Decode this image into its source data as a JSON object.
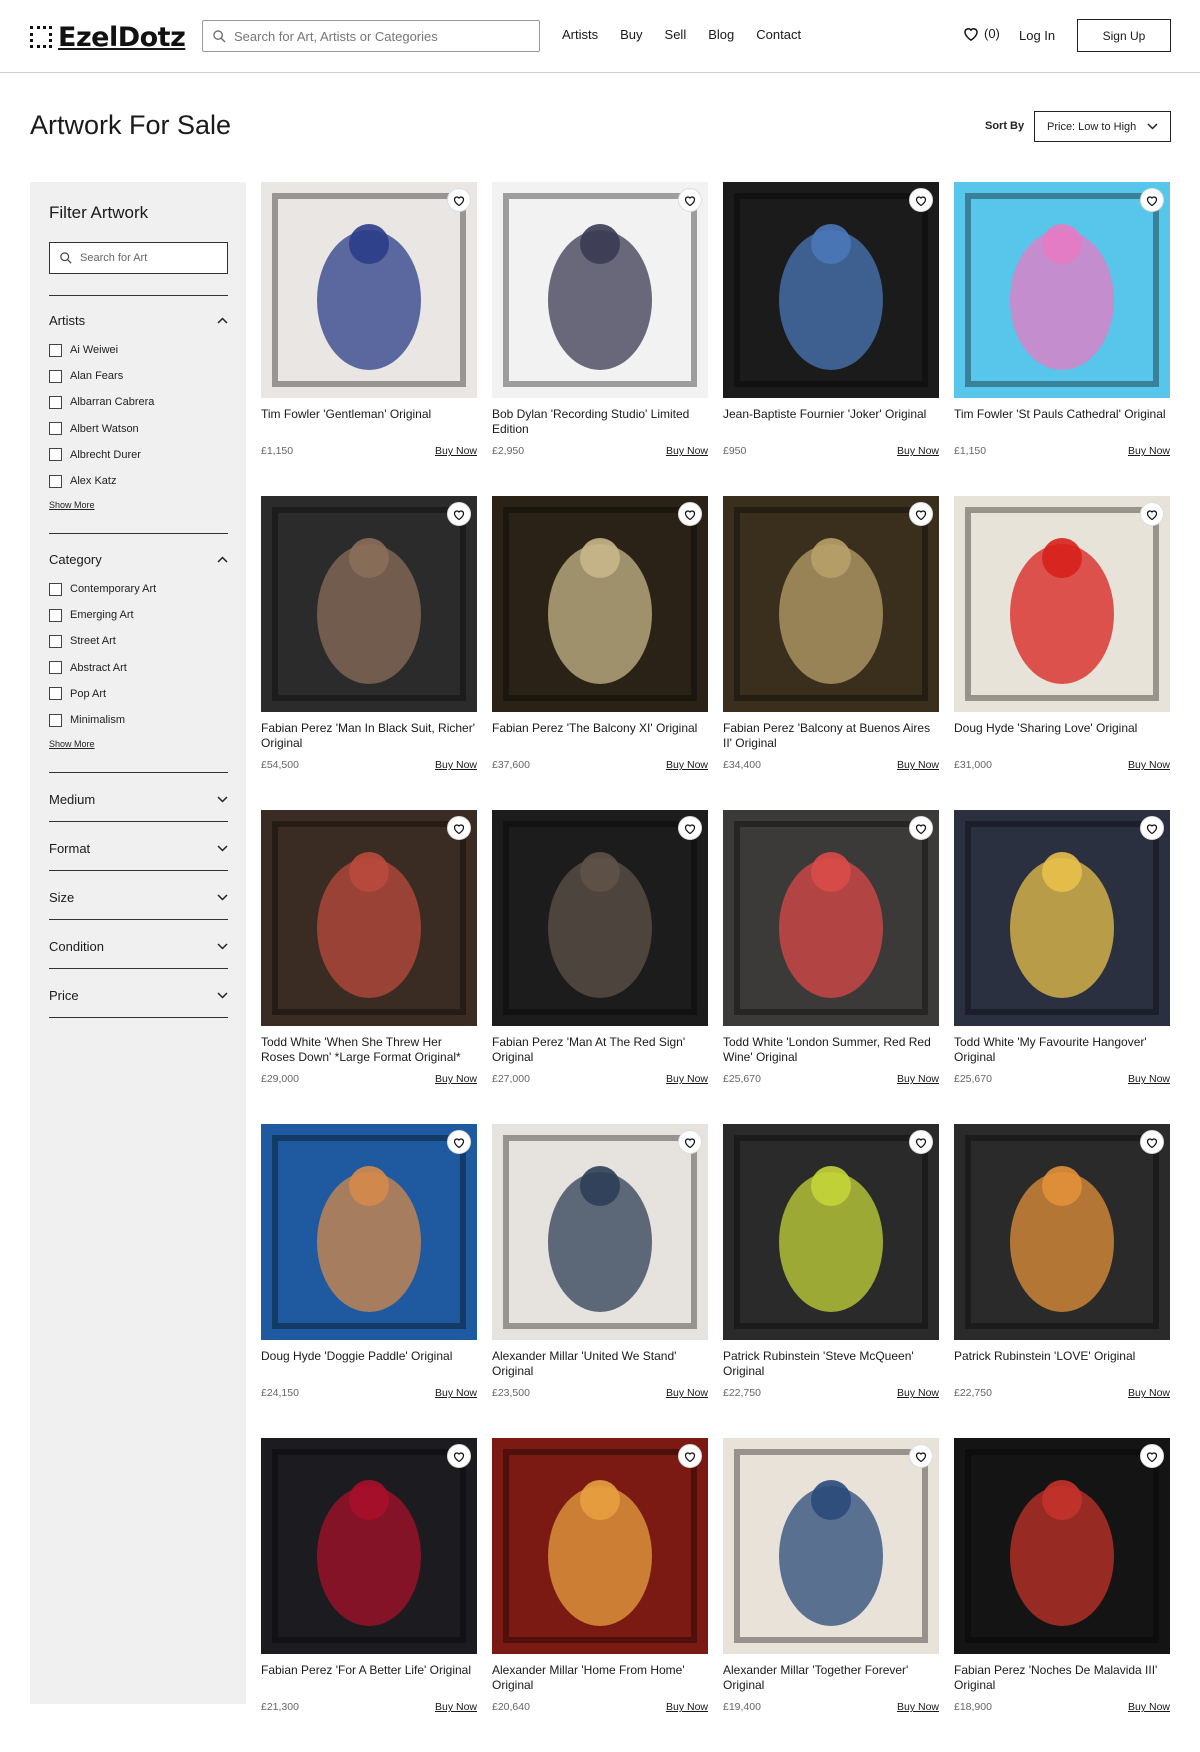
{
  "header": {
    "logo_text": "EzelDotz",
    "search_placeholder": "Search for Art, Artists or Categories",
    "nav": [
      "Artists",
      "Buy",
      "Sell",
      "Blog",
      "Contact"
    ],
    "favourites_count": "(0)",
    "login_label": "Log In",
    "signup_label": "Sign Up"
  },
  "page": {
    "title": "Artwork For Sale",
    "sort_label": "Sort By",
    "sort_value": "Price: Low to High"
  },
  "sidebar": {
    "title": "Filter Artwork",
    "search_placeholder": "Search for Art",
    "artists": {
      "label": "Artists",
      "options": [
        "Ai Weiwei",
        "Alan Fears",
        "Albarran Cabrera",
        "Albert Watson",
        "Albrecht Durer",
        "Alex Katz"
      ],
      "show_more": "Show More"
    },
    "category": {
      "label": "Category",
      "options": [
        "Contemporary Art",
        "Emerging Art",
        "Street Art",
        "Abstract Art",
        "Pop Art",
        "Minimalism"
      ],
      "show_more": "Show More"
    },
    "collapsed": [
      "Medium",
      "Format",
      "Size",
      "Condition",
      "Price"
    ]
  },
  "buy_label": "Buy Now",
  "products": [
    {
      "title": "Tim Fowler 'Gentleman' Original",
      "price": "£1,150",
      "bg": "#e9e6e3",
      "fg": "#2a3d88"
    },
    {
      "title": "Bob Dylan 'Recording Studio' Limited Edition",
      "price": "£2,950",
      "bg": "#f2f2f2",
      "fg": "#3a3a52"
    },
    {
      "title": "Jean-Baptiste Fournier 'Joker' Original",
      "price": "£950",
      "bg": "#1b1b1b",
      "fg": "#4a78b8"
    },
    {
      "title": "Tim Fowler 'St Pauls Cathedral' Original",
      "price": "£1,150",
      "bg": "#58c6ea",
      "fg": "#e77ac4"
    },
    {
      "title": "Fabian Perez 'Man In Black Suit, Richer' Original",
      "price": "£54,500",
      "bg": "#2b2b2b",
      "fg": "#8a6e5a"
    },
    {
      "title": "Fabian Perez 'The Balcony XI' Original",
      "price": "£37,600",
      "bg": "#2a2216",
      "fg": "#c7b78a"
    },
    {
      "title": "Fabian Perez 'Balcony at Buenos Aires II' Original",
      "price": "£34,400",
      "bg": "#3a2e1c",
      "fg": "#b8a06a"
    },
    {
      "title": "Doug Hyde 'Sharing Love' Original",
      "price": "£31,000",
      "bg": "#e8e3d8",
      "fg": "#d8201c"
    },
    {
      "title": "Todd White 'When She Threw Her Roses Down' *Large Format Original*",
      "price": "£29,000",
      "bg": "#3a2c22",
      "fg": "#b94a3c"
    },
    {
      "title": "Fabian Perez 'Man At The Red Sign' Original",
      "price": "£27,000",
      "bg": "#1c1c1c",
      "fg": "#5e5248"
    },
    {
      "title": "Todd White 'London Summer, Red Red Wine' Original",
      "price": "£25,670",
      "bg": "#3c3a38",
      "fg": "#d94a48"
    },
    {
      "title": "Todd White 'My Favourite Hangover' Original",
      "price": "£25,670",
      "bg": "#2b3040",
      "fg": "#e8c04a"
    },
    {
      "title": "Doug Hyde 'Doggie Paddle' Original",
      "price": "£24,150",
      "bg": "#1f5aa0",
      "fg": "#d5894a"
    },
    {
      "title": "Alexander Millar 'United We Stand' Original",
      "price": "£23,500",
      "bg": "#e6e3de",
      "fg": "#2e3e56"
    },
    {
      "title": "Patrick Rubinstein 'Steve McQueen' Original",
      "price": "£22,750",
      "bg": "#2a2a2a",
      "fg": "#c4d43a"
    },
    {
      "title": "Patrick Rubinstein 'LOVE' Original",
      "price": "£22,750",
      "bg": "#2a2a2a",
      "fg": "#e2903a"
    },
    {
      "title": "Fabian Perez 'For A Better Life' Original",
      "price": "£21,300",
      "bg": "#1c1c20",
      "fg": "#a8102a"
    },
    {
      "title": "Alexander Millar 'Home From Home' Original",
      "price": "£20,640",
      "bg": "#7a1a12",
      "fg": "#e8a040"
    },
    {
      "title": "Alexander Millar 'Together Forever' Original",
      "price": "£19,400",
      "bg": "#e8e2d8",
      "fg": "#2a4a7a"
    },
    {
      "title": "Fabian Perez 'Noches De Malavida III' Original",
      "price": "£18,900",
      "bg": "#141414",
      "fg": "#c4322a"
    }
  ]
}
